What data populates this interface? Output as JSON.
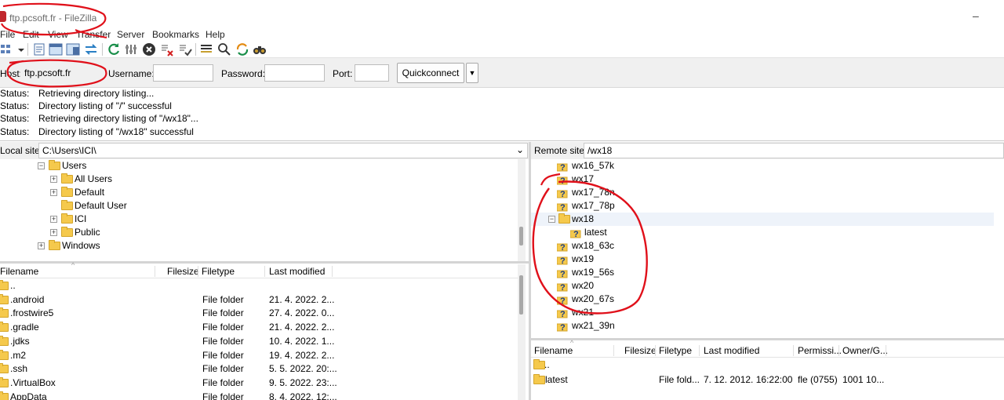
{
  "window": {
    "title": "ftp.pcsoft.fr - FileZilla",
    "minimize_glyph": "–"
  },
  "menu": [
    "File",
    "Edit",
    "View",
    "Transfer",
    "Server",
    "Bookmarks",
    "Help"
  ],
  "toolbar": [
    "site-manager-icon",
    "dropdown-arrow-icon",
    "toggle-message-log-icon",
    "toggle-local-tree-icon",
    "toggle-remote-tree-icon",
    "toggle-transfer-queue-icon",
    "refresh-icon",
    "process-queue-icon",
    "cancel-icon",
    "disconnect-icon",
    "reconnect-icon",
    "filter-icon",
    "compare-icon",
    "sync-browse-icon",
    "find-icon"
  ],
  "quickconnect": {
    "host_label": "Host:",
    "host_value": "ftp.pcsoft.fr",
    "username_label": "Username:",
    "username_value": "",
    "password_label": "Password:",
    "password_value": "",
    "port_label": "Port:",
    "port_value": "",
    "button_label": "Quickconnect",
    "dropdown_glyph": "▼"
  },
  "log": [
    {
      "label": "Status:",
      "message": "Retrieving directory listing..."
    },
    {
      "label": "Status:",
      "message": "Directory listing of \"/\" successful"
    },
    {
      "label": "Status:",
      "message": "Retrieving directory listing of \"/wx18\"..."
    },
    {
      "label": "Status:",
      "message": "Directory listing of \"/wx18\" successful"
    }
  ],
  "local": {
    "site_label": "Local site:",
    "path": "C:\\Users\\ICI\\",
    "dropdown_glyph": "⌄",
    "tree": [
      {
        "label": "Users",
        "expander": "−"
      },
      {
        "label": "All Users",
        "expander": "+"
      },
      {
        "label": "Default",
        "expander": "+"
      },
      {
        "label": "Default User",
        "expander": ""
      },
      {
        "label": "ICI",
        "expander": "+"
      },
      {
        "label": "Public",
        "expander": "+"
      },
      {
        "label": "Windows",
        "expander": "+"
      }
    ],
    "columns": [
      "Filename",
      "Filesize",
      "Filetype",
      "Last modified"
    ],
    "files": [
      {
        "name": "..",
        "size": "",
        "type": "",
        "modified": ""
      },
      {
        "name": ".android",
        "size": "",
        "type": "File folder",
        "modified": "21. 4. 2022. 2..."
      },
      {
        "name": ".frostwire5",
        "size": "",
        "type": "File folder",
        "modified": "27. 4. 2022. 0..."
      },
      {
        "name": ".gradle",
        "size": "",
        "type": "File folder",
        "modified": "21. 4. 2022. 2..."
      },
      {
        "name": ".jdks",
        "size": "",
        "type": "File folder",
        "modified": "10. 4. 2022. 1..."
      },
      {
        "name": ".m2",
        "size": "",
        "type": "File folder",
        "modified": "19. 4. 2022. 2..."
      },
      {
        "name": ".ssh",
        "size": "",
        "type": "File folder",
        "modified": "5. 5. 2022. 20:..."
      },
      {
        "name": ".VirtualBox",
        "size": "",
        "type": "File folder",
        "modified": "9. 5. 2022. 23:..."
      },
      {
        "name": "AppData",
        "size": "",
        "type": "File folder",
        "modified": "8. 4. 2022. 12:..."
      }
    ]
  },
  "remote": {
    "site_label": "Remote site:",
    "path": "/wx18",
    "tree": [
      {
        "label": "wx16_57k",
        "kind": "unknown"
      },
      {
        "label": "wx17",
        "kind": "unknown"
      },
      {
        "label": "wx17_78n",
        "kind": "unknown"
      },
      {
        "label": "wx17_78p",
        "kind": "unknown"
      },
      {
        "label": "wx18",
        "kind": "folder",
        "expander": "−"
      },
      {
        "label": "latest",
        "kind": "unknown-child"
      },
      {
        "label": "wx18_63c",
        "kind": "unknown"
      },
      {
        "label": "wx19",
        "kind": "unknown"
      },
      {
        "label": "wx19_56s",
        "kind": "unknown"
      },
      {
        "label": "wx20",
        "kind": "unknown"
      },
      {
        "label": "wx20_67s",
        "kind": "unknown"
      },
      {
        "label": "wx21",
        "kind": "unknown"
      },
      {
        "label": "wx21_39n",
        "kind": "unknown"
      }
    ],
    "columns": [
      "Filename",
      "Filesize",
      "Filetype",
      "Last modified",
      "Permissi...",
      "Owner/G..."
    ],
    "files": [
      {
        "name": "..",
        "size": "",
        "type": "",
        "modified": "",
        "perms": "",
        "owner": ""
      },
      {
        "name": "latest",
        "size": "",
        "type": "File fold...",
        "modified": "7. 12. 2012. 16:22:00",
        "perms": "fle (0755)",
        "owner": "1001 10..."
      }
    ]
  },
  "colors": {
    "annotation": "#e0101a",
    "folder": "#f5c94c"
  }
}
